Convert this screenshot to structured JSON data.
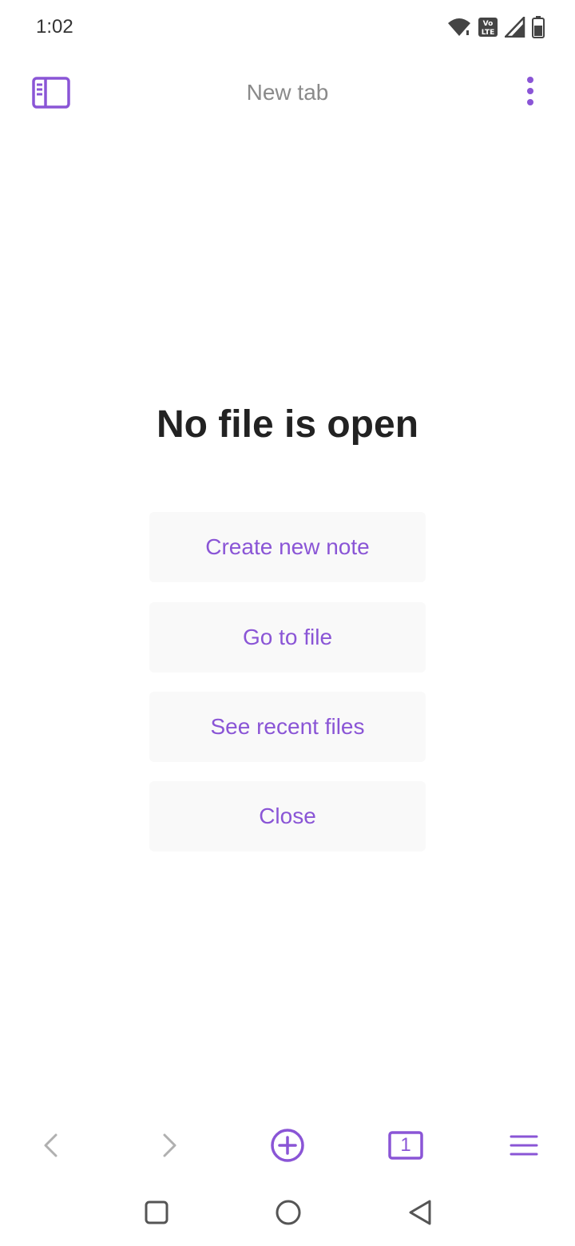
{
  "status_bar": {
    "time": "1:02",
    "icons": [
      "wifi-icon",
      "volte-icon",
      "signal-icon",
      "battery-icon"
    ]
  },
  "header": {
    "title": "New tab",
    "left_icon": "sidebar-toggle-icon",
    "right_icon": "more-vertical-icon"
  },
  "main": {
    "title": "No file is open",
    "actions": [
      {
        "label": "Create new note"
      },
      {
        "label": "Go to file"
      },
      {
        "label": "See recent files"
      },
      {
        "label": "Close"
      }
    ]
  },
  "bottom_toolbar": {
    "icons": [
      "back-arrow-icon",
      "forward-arrow-icon",
      "add-circle-icon",
      "tabs-icon",
      "menu-icon"
    ],
    "tab_count": "1"
  },
  "android_nav": {
    "icons": [
      "recents-icon",
      "home-icon",
      "back-icon"
    ]
  },
  "colors": {
    "accent": "#8a55d6",
    "disabled": "#b0b0b0",
    "button_bg": "#f9f9f9",
    "title_text": "#222222",
    "muted_text": "#8a8a8a"
  }
}
